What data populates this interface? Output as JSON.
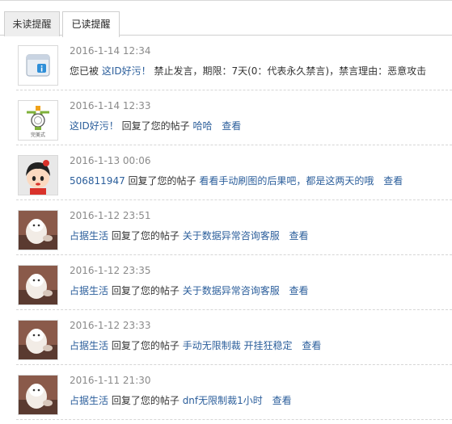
{
  "tabs": {
    "unread_label": "未读提醒",
    "read_label": "已读提醒"
  },
  "colors": {
    "link": "#2b5e9b",
    "time": "#8a8a8a",
    "text": "#333333"
  },
  "notifications": [
    {
      "avatar_icon": "system-notice-icon",
      "time": "2016-1-14 12:34",
      "pre": "您已被",
      "link1": "这ID好污！",
      "text": "禁止发言，期限：7天(0：代表永久禁言)，禁言理由：恶意攻击",
      "link2": "",
      "view": ""
    },
    {
      "avatar_icon": "trophy-badge-icon",
      "avatar_caption": "完美式",
      "time": "2016-1-14 12:33",
      "pre": "",
      "link1": "这ID好污！",
      "text": "回复了您的帖子",
      "link2": "哈哈",
      "view": "查看"
    },
    {
      "avatar_icon": "cartoon-girl-avatar",
      "time": "2016-1-13 00:06",
      "pre": "",
      "link1": "506811947",
      "text": "回复了您的帖子",
      "link2": "看看手动刷图的后果吧，都是这两天的哦",
      "view": "查看"
    },
    {
      "avatar_icon": "cat-photo-avatar",
      "time": "2016-1-12 23:51",
      "pre": "",
      "link1": "占据生活",
      "text": "回复了您的帖子",
      "link2": "关于数据异常咨询客服",
      "view": "查看"
    },
    {
      "avatar_icon": "cat-photo-avatar",
      "time": "2016-1-12 23:35",
      "pre": "",
      "link1": "占据生活",
      "text": "回复了您的帖子",
      "link2": "关于数据异常咨询客服",
      "view": "查看"
    },
    {
      "avatar_icon": "cat-photo-avatar",
      "time": "2016-1-12 23:33",
      "pre": "",
      "link1": "占据生活",
      "text": "回复了您的帖子",
      "link2": "手动无限制裁 开挂狂稳定",
      "view": "查看"
    },
    {
      "avatar_icon": "cat-photo-avatar",
      "time": "2016-1-11 21:30",
      "pre": "",
      "link1": "占据生活",
      "text": "回复了您的帖子",
      "link2": "dnf无限制裁1小时",
      "view": "查看"
    }
  ]
}
